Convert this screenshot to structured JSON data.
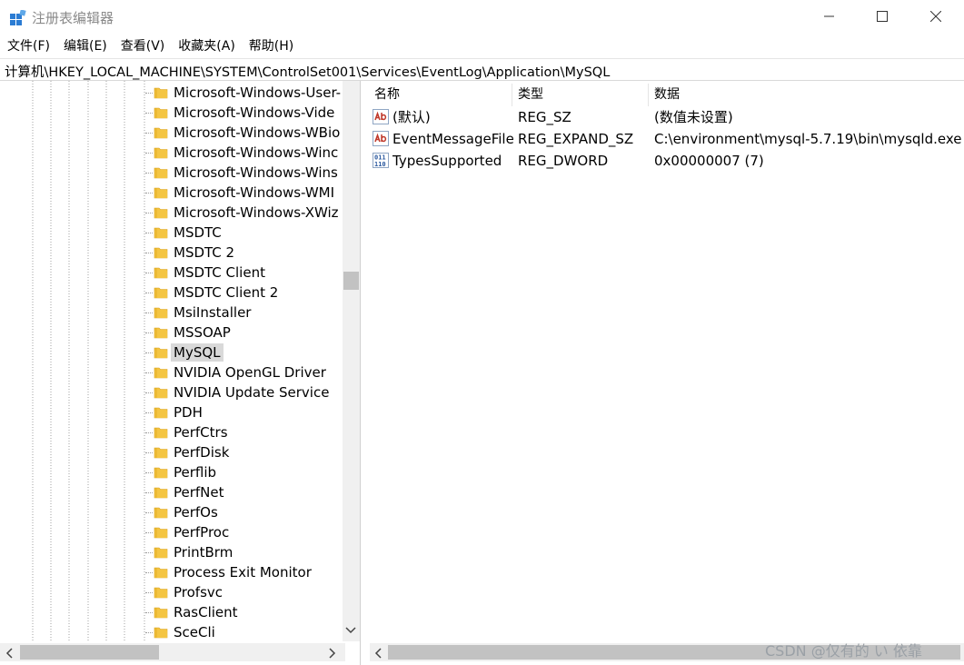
{
  "window": {
    "title": "注册表编辑器",
    "minimize_glyph": "—",
    "maximize_glyph": "☐",
    "close_glyph": "✕"
  },
  "menu": [
    "文件(F)",
    "编辑(E)",
    "查看(V)",
    "收藏夹(A)",
    "帮助(H)"
  ],
  "address": "计算机\\HKEY_LOCAL_MACHINE\\SYSTEM\\ControlSet001\\Services\\EventLog\\Application\\MySQL",
  "tree": {
    "items": [
      "Microsoft-Windows-User-",
      "Microsoft-Windows-Vide",
      "Microsoft-Windows-WBio",
      "Microsoft-Windows-Winc",
      "Microsoft-Windows-Wins",
      "Microsoft-Windows-WMI",
      "Microsoft-Windows-XWiz",
      "MSDTC",
      "MSDTC 2",
      "MSDTC Client",
      "MSDTC Client 2",
      "MsiInstaller",
      "MSSOAP",
      "MySQL",
      "NVIDIA OpenGL Driver",
      "NVIDIA Update Service",
      "PDH",
      "PerfCtrs",
      "PerfDisk",
      "Perflib",
      "PerfNet",
      "PerfOs",
      "PerfProc",
      "PrintBrm",
      "Process Exit Monitor",
      "Profsvc",
      "RasClient",
      "SceCli"
    ],
    "selected": "MySQL"
  },
  "values": {
    "headers": {
      "name": "名称",
      "type": "类型",
      "data": "数据"
    },
    "rows": [
      {
        "icon": "string-value-icon",
        "name": "(默认)",
        "type": "REG_SZ",
        "data": "(数值未设置)"
      },
      {
        "icon": "string-value-icon",
        "name": "EventMessageFile",
        "type": "REG_EXPAND_SZ",
        "data": "C:\\environment\\mysql-5.7.19\\bin\\mysqld.exe"
      },
      {
        "icon": "binary-value-icon",
        "name": "TypesSupported",
        "type": "REG_DWORD",
        "data": "0x00000007 (7)"
      }
    ]
  },
  "watermark": "CSDN @仅有的 い 依靠",
  "colors": {
    "folder": "#f4c542",
    "folder_dark": "#d9a31e",
    "selected_bg": "#d9d9d9",
    "scrollbar_thumb": "#c2c2c2",
    "string_icon_red": "#c0392b",
    "binary_icon_blue": "#2c5aa0"
  }
}
